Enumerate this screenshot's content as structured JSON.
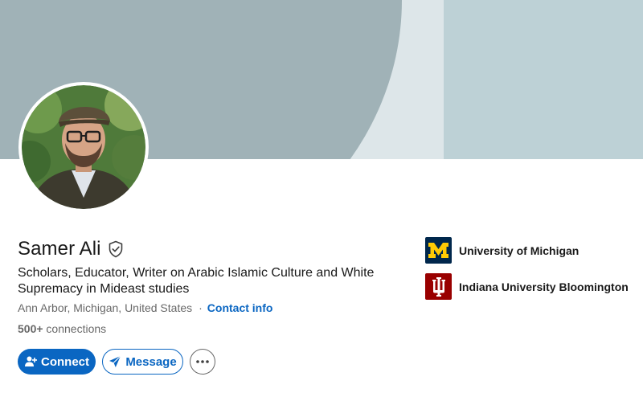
{
  "profile": {
    "name": "Samer Ali",
    "headline": "Scholars, Educator, Writer on Arabic Islamic Culture and White Supremacy in Mideast studies",
    "location": "Ann Arbor, Michigan, United States",
    "separator": "·",
    "contact_info": "Contact info",
    "connections_count": "500+",
    "connections_label": " connections"
  },
  "actions": {
    "connect_label": "Connect",
    "message_label": "Message"
  },
  "education": [
    {
      "name": "University of Michigan",
      "logo_icon": "university-of-michigan-logo",
      "logo_bg": "#00274c",
      "logo_fg": "#ffcb05"
    },
    {
      "name": "Indiana University Bloomington",
      "logo_icon": "indiana-university-logo",
      "logo_bg": "#990000",
      "logo_fg": "#ffffff"
    }
  ],
  "colors": {
    "accent": "#0a66c2",
    "banner_dark": "#a0b2b7",
    "banner_light": "#dde6e9",
    "banner_right": "#bdd1d6"
  }
}
